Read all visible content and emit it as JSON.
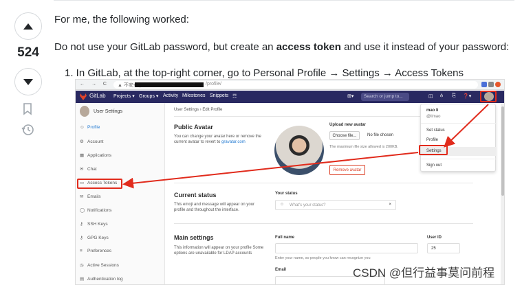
{
  "vote": {
    "count": "524"
  },
  "answer": {
    "p1": "For me, the following worked:",
    "p2_before": "Do not use your GitLab password, but create an ",
    "p2_bold": "access token",
    "p2_after": " and use it instead of your password:",
    "step1": "1. In GitLab, at the top-right corner, go to Personal Profile → Settings → Access Tokens"
  },
  "screenshot": {
    "browser": {
      "security": "▲ 不安全 |",
      "url_tail": "/profile/"
    },
    "gitlab_nav": {
      "brand": "GitLab",
      "items": [
        "Projects ▾",
        "Groups ▾",
        "Activity",
        "Milestones",
        "Snippets",
        "☶"
      ],
      "search_placeholder": "Search or jump to..."
    },
    "sidebar": {
      "title": "User Settings",
      "items": [
        {
          "icon": "☺",
          "label": "Profile"
        },
        {
          "icon": "⚙",
          "label": "Account"
        },
        {
          "icon": "▦",
          "label": "Applications"
        },
        {
          "icon": "✉",
          "label": "Chat"
        },
        {
          "icon": "▭",
          "label": "Access Tokens"
        },
        {
          "icon": "✉",
          "label": "Emails"
        },
        {
          "icon": "◯",
          "label": "Notifications"
        },
        {
          "icon": "⚷",
          "label": "SSH Keys"
        },
        {
          "icon": "⚷",
          "label": "GPG Keys"
        },
        {
          "icon": "≡",
          "label": "Preferences"
        },
        {
          "icon": "◷",
          "label": "Active Sessions"
        },
        {
          "icon": "▤",
          "label": "Authentication log"
        }
      ]
    },
    "breadcrumb": "User Settings  ›  Edit Profile",
    "avatar_section": {
      "title": "Public Avatar",
      "desc": "You can change your avatar here or remove the current avatar to revert to",
      "link": "gravatar.com",
      "upload_label": "Upload new avatar",
      "choose_btn": "Choose file...",
      "no_file": "No file chosen",
      "max_size": "The maximum file size allowed is 200KB.",
      "remove_btn": "Remove avatar"
    },
    "status_section": {
      "title": "Current status",
      "desc": "This emoji and message will appear on your profile and throughout the interface.",
      "field_label": "Your status",
      "placeholder": "What's your status?",
      "clear": "×"
    },
    "main_section": {
      "title": "Main settings",
      "desc": "This information will appear on your profile Some options are unavailable for LDAP accounts",
      "fullname_label": "Full name",
      "fullname_hint": "Enter your name, so people you know can recognize you",
      "userid_label": "User ID",
      "userid_value": "25",
      "email_label": "Email"
    },
    "user_menu": {
      "name": "mao li",
      "handle": "@limao",
      "items": [
        "Set status",
        "Profile",
        "Settings",
        "Sign out"
      ]
    }
  },
  "watermark": "CSDN @但行益事莫问前程",
  "colors": {
    "gitlab_nav": "#292961",
    "highlight_red": "#e12b1c",
    "link_blue": "#1f78d1"
  }
}
